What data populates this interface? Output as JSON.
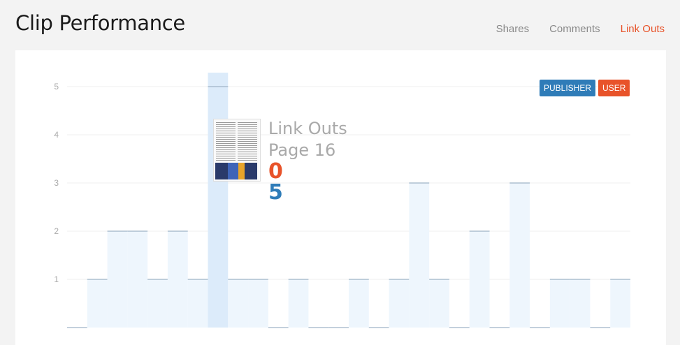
{
  "page": {
    "title": "Clip Performance"
  },
  "tabs": [
    {
      "label": "Shares",
      "active": false
    },
    {
      "label": "Comments",
      "active": false
    },
    {
      "label": "Link Outs",
      "active": true
    }
  ],
  "legend": {
    "publisher": "PUBLISHER",
    "user": "USER"
  },
  "colors": {
    "publisher": "#2f7cb8",
    "user": "#e8532a",
    "bar": "#eef6fd",
    "highlight": "#dcebfa",
    "line": "#9fb3c6"
  },
  "tooltip": {
    "title": "Link Outs",
    "page": "Page 16",
    "user_value": "0",
    "publisher_value": "5",
    "thumbnail_icon": "page-thumbnail-image"
  },
  "chart_data": {
    "type": "bar",
    "title": "",
    "xlabel": "",
    "ylabel": "",
    "ylim": [
      0,
      5
    ],
    "yticks": [
      1,
      2,
      3,
      4,
      5
    ],
    "grid": true,
    "highlight_index": 7,
    "series": [
      {
        "name": "PUBLISHER",
        "values": [
          0,
          1,
          2,
          2,
          1,
          2,
          1,
          5,
          1,
          1,
          0,
          1,
          0,
          0,
          1,
          0,
          1,
          3,
          1,
          0,
          2,
          0,
          3,
          0,
          1,
          1,
          0,
          1
        ]
      }
    ]
  }
}
